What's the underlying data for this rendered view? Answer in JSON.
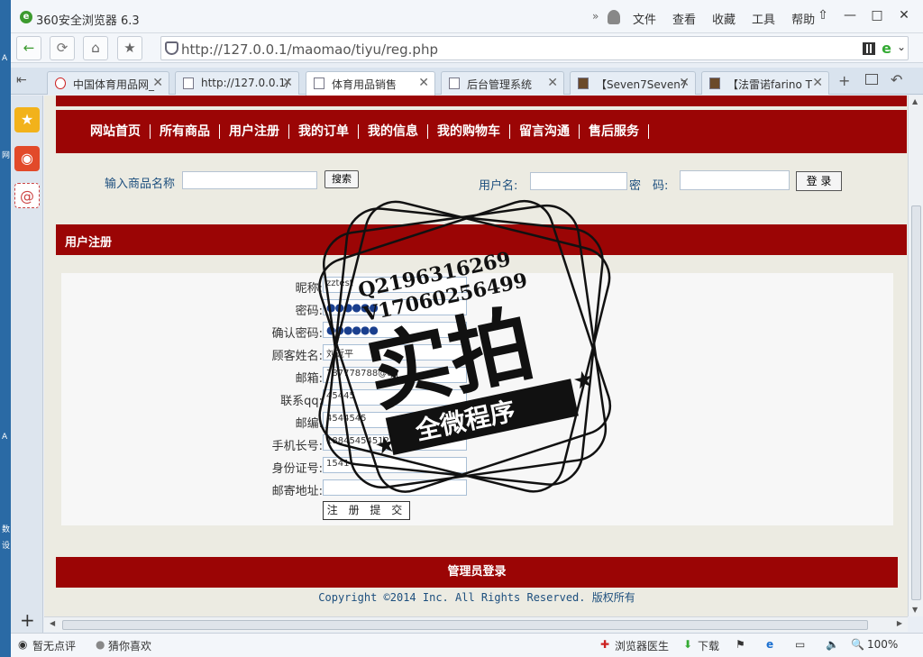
{
  "window": {
    "title": "360安全浏览器 6.3",
    "menus": [
      "文件",
      "查看",
      "收藏",
      "工具",
      "帮助"
    ]
  },
  "desktop": {
    "labels": [
      "A",
      "网",
      "A",
      "数",
      "设"
    ]
  },
  "address": {
    "url": "http://127.0.0.1/maomao/tiyu/reg.php"
  },
  "tabs": [
    {
      "label": "中国体育用品网_"
    },
    {
      "label": "http://127.0.0.1/"
    },
    {
      "label": "体育用品销售"
    },
    {
      "label": "后台管理系统"
    },
    {
      "label": "【Seven7Seven7"
    },
    {
      "label": "【法雷诺farino T"
    }
  ],
  "site": {
    "nav": [
      "网站首页",
      "所有商品",
      "用户注册",
      "我的订单",
      "我的信息",
      "我的购物车",
      "留言沟通",
      "售后服务"
    ],
    "search_label": "输入商品名称",
    "search_button": "搜索",
    "username_label": "用户名:",
    "password_label": "密　码:",
    "login_button": "登 录",
    "section_title": "用户注册",
    "form": [
      {
        "label": "昵称:",
        "value": "zztest"
      },
      {
        "label": "密码:",
        "value": "●●●●●●"
      },
      {
        "label": "确认密码:",
        "value": "●●●●●●"
      },
      {
        "label": "顾客姓名:",
        "value": "刘近平"
      },
      {
        "label": "邮箱:",
        "value": "787778788@qq"
      },
      {
        "label": "联系qq:",
        "value": "45445"
      },
      {
        "label": "邮编:",
        "value": "4544545"
      },
      {
        "label": "手机长号:",
        "value": "18845454512"
      },
      {
        "label": "身份证号:",
        "value": "1541"
      },
      {
        "label": "邮寄地址:",
        "value": ""
      }
    ],
    "submit_button": "注 册 提 交",
    "footer_link": "管理员登录",
    "copyright": "Copyright ©2014 Inc. All Rights Reserved. 版权所有"
  },
  "watermark": {
    "line1": "Q2196316269",
    "line2": "V17060256499",
    "big": "实拍",
    "banner": "全微程序"
  },
  "status": {
    "left1": "暂无点评",
    "left2": "猜你喜欢",
    "doctor": "浏览器医生",
    "download": "下载",
    "zoom": "100%"
  },
  "colors": {
    "brand_red": "#9b0505",
    "link_blue": "#1d4f7e"
  }
}
